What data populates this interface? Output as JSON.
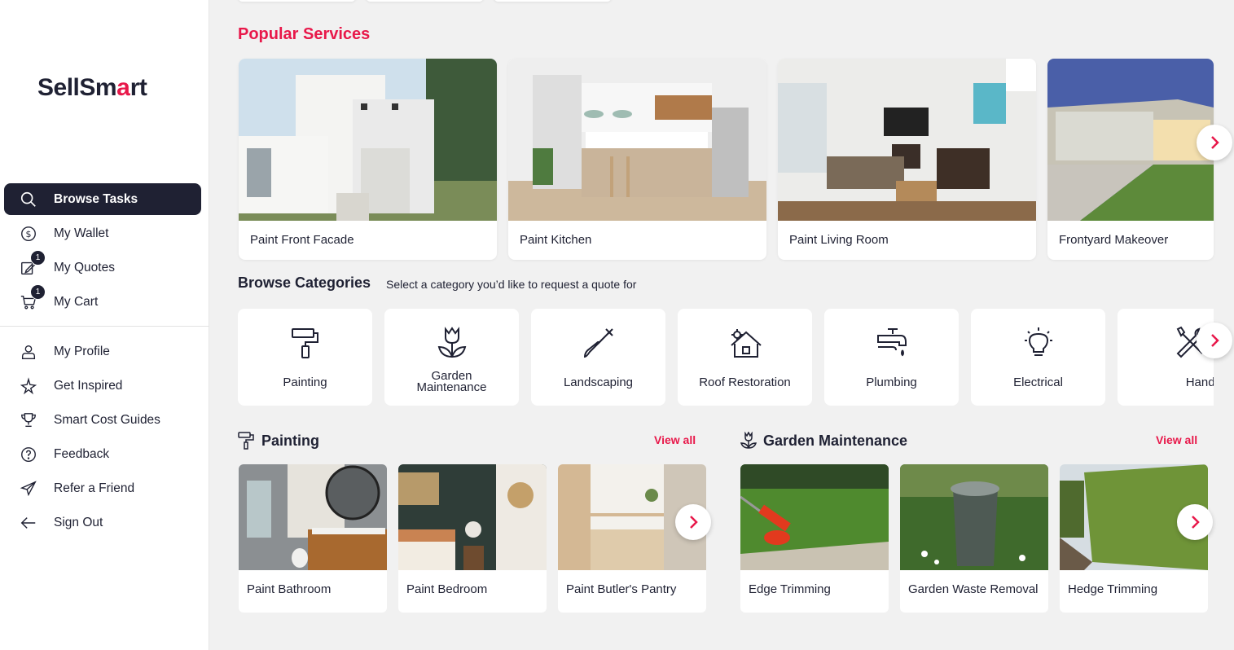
{
  "brand": {
    "name_part1": "SellSm",
    "name_accent": "a",
    "name_part2": "rt"
  },
  "sidebar": {
    "items": [
      {
        "label": "Browse Tasks",
        "icon": "search-icon",
        "active": true
      },
      {
        "label": "My Wallet",
        "icon": "dollar-coin-icon"
      },
      {
        "label": "My Quotes",
        "icon": "quote-edit-icon",
        "badge": "1"
      },
      {
        "label": "My Cart",
        "icon": "cart-icon",
        "badge": "1"
      },
      {
        "label": "My Profile",
        "icon": "user-icon"
      },
      {
        "label": "Get Inspired",
        "icon": "sparkle-star-icon"
      },
      {
        "label": "Smart Cost Guides",
        "icon": "trophy-icon"
      },
      {
        "label": "Feedback",
        "icon": "question-circle-icon"
      },
      {
        "label": "Refer a Friend",
        "icon": "paper-plane-icon"
      },
      {
        "label": "Sign Out",
        "icon": "arrow-left-icon"
      }
    ]
  },
  "popular": {
    "title": "Popular Services",
    "cards": [
      {
        "label": "Paint Front Facade"
      },
      {
        "label": "Paint Kitchen"
      },
      {
        "label": "Paint Living Room"
      },
      {
        "label": "Frontyard Makeover"
      }
    ]
  },
  "categories": {
    "title": "Browse Categories",
    "subtitle": "Select a category you’d like to request a quote for",
    "items": [
      {
        "label": "Painting",
        "icon": "paint-roller-icon"
      },
      {
        "label_line1": "Garden",
        "label_line2": "Maintenance",
        "icon": "tulip-icon"
      },
      {
        "label": "Landscaping",
        "icon": "shovel-icon"
      },
      {
        "label": "Roof Restoration",
        "icon": "house-gear-icon"
      },
      {
        "label": "Plumbing",
        "icon": "tap-icon"
      },
      {
        "label": "Electrical",
        "icon": "lightbulb-icon"
      },
      {
        "label": "Handyman",
        "icon": "tools-icon"
      }
    ]
  },
  "painting": {
    "title": "Painting",
    "view_all": "View all",
    "cards": [
      {
        "label": "Paint Bathroom"
      },
      {
        "label": "Paint Bedroom"
      },
      {
        "label": "Paint Butler's Pantry"
      }
    ]
  },
  "garden": {
    "title": "Garden Maintenance",
    "view_all": "View all",
    "cards": [
      {
        "label": "Edge Trimming"
      },
      {
        "label": "Garden Waste Removal"
      },
      {
        "label": "Hedge Trimming"
      }
    ]
  },
  "colors": {
    "accent": "#e8184a",
    "navy": "#1f2133",
    "background": "#f1f1f1"
  }
}
